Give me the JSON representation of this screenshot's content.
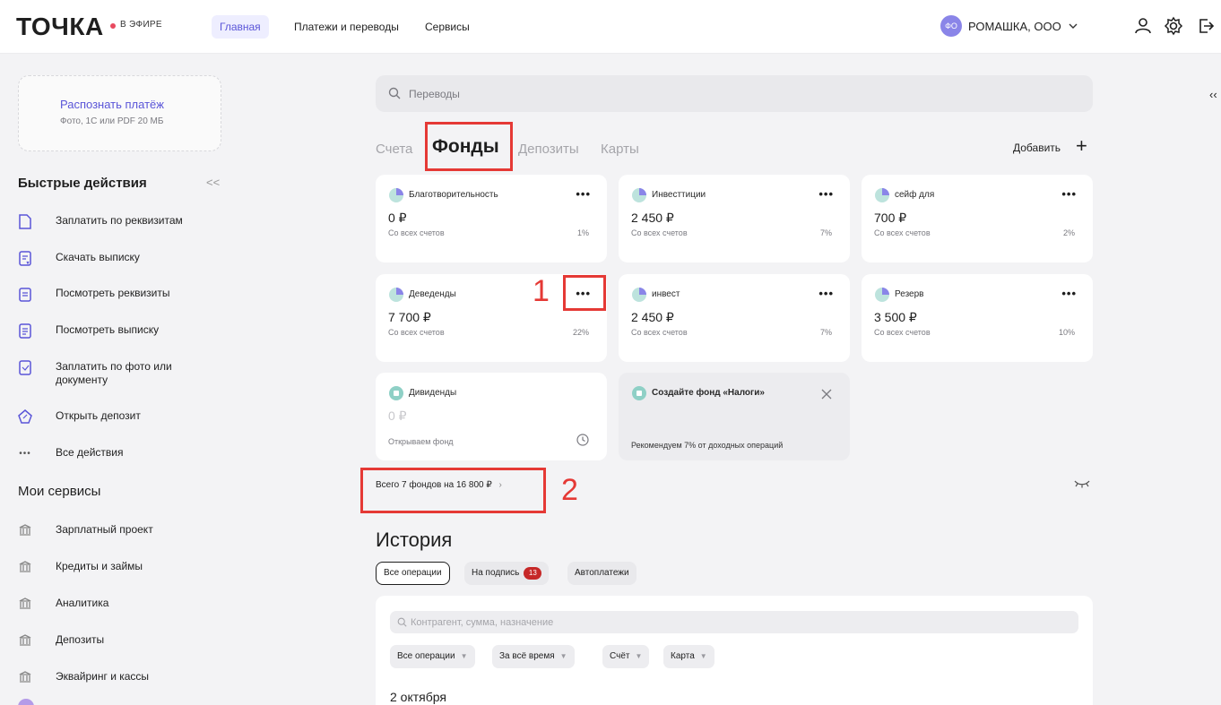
{
  "header": {
    "logo": "ТОЧКА",
    "live": "В ЭФИРЕ",
    "nav": [
      "Главная",
      "Платежи и переводы",
      "Сервисы"
    ],
    "company_avatar": "ФО",
    "company_name": "РОМАШКА, ООО"
  },
  "sidebar": {
    "recognize_title": "Распознать платёж",
    "recognize_sub": "Фото, 1С или PDF 20 МБ",
    "quick_title": "Быстрые действия",
    "quick_items": [
      "Заплатить по реквизитам",
      "Скачать выписку",
      "Посмотреть реквизиты",
      "Посмотреть выписку",
      "Заплатить по фото или документу",
      "Открыть депозит",
      "Все действия"
    ],
    "services_title": "Мои сервисы",
    "services": [
      "Зарплатный проект",
      "Кредиты и займы",
      "Аналитика",
      "Депозиты",
      "Эквайринг и кассы"
    ]
  },
  "main": {
    "search_placeholder": "Переводы",
    "tabs": [
      "Счета",
      "Фонды",
      "Депозиты",
      "Карты"
    ],
    "add_label": "Добавить",
    "funds": [
      {
        "name": "Благотворительность",
        "amount": "0 ₽",
        "sub": "Со всех счетов",
        "pct": "1%"
      },
      {
        "name": "Инвесттиции",
        "amount": "2 450 ₽",
        "sub": "Со всех счетов",
        "pct": "7%"
      },
      {
        "name": "сейф для",
        "amount": "700 ₽",
        "sub": "Со всех счетов",
        "pct": "2%"
      },
      {
        "name": "Деведенды",
        "amount": "7 700 ₽",
        "sub": "Со всех счетов",
        "pct": "22%"
      },
      {
        "name": "инвест",
        "amount": "2 450 ₽",
        "sub": "Со всех счетов",
        "pct": "7%"
      },
      {
        "name": "Резерв",
        "amount": "3 500 ₽",
        "sub": "Со всех счетов",
        "pct": "10%"
      },
      {
        "name": "Дивиденды",
        "amount": "0 ₽",
        "sub": "Открываем фонд",
        "pct": ""
      }
    ],
    "promo_title": "Создайте фонд «Налоги»",
    "promo_sub": "Рекомендуем 7% от доходных операций",
    "total": "Всего 7 фондов на 16 800 ₽",
    "annotations": [
      "1",
      "2"
    ],
    "history_title": "История",
    "history_chips": [
      "Все операции",
      "На подпись",
      "Автоплатежи"
    ],
    "sign_count": "13",
    "history_search_placeholder": "Контрагент, сумма, назначение",
    "filters": [
      "Все операции",
      "За всё время",
      "Счёт",
      "Карта"
    ],
    "date": "2 октября"
  }
}
